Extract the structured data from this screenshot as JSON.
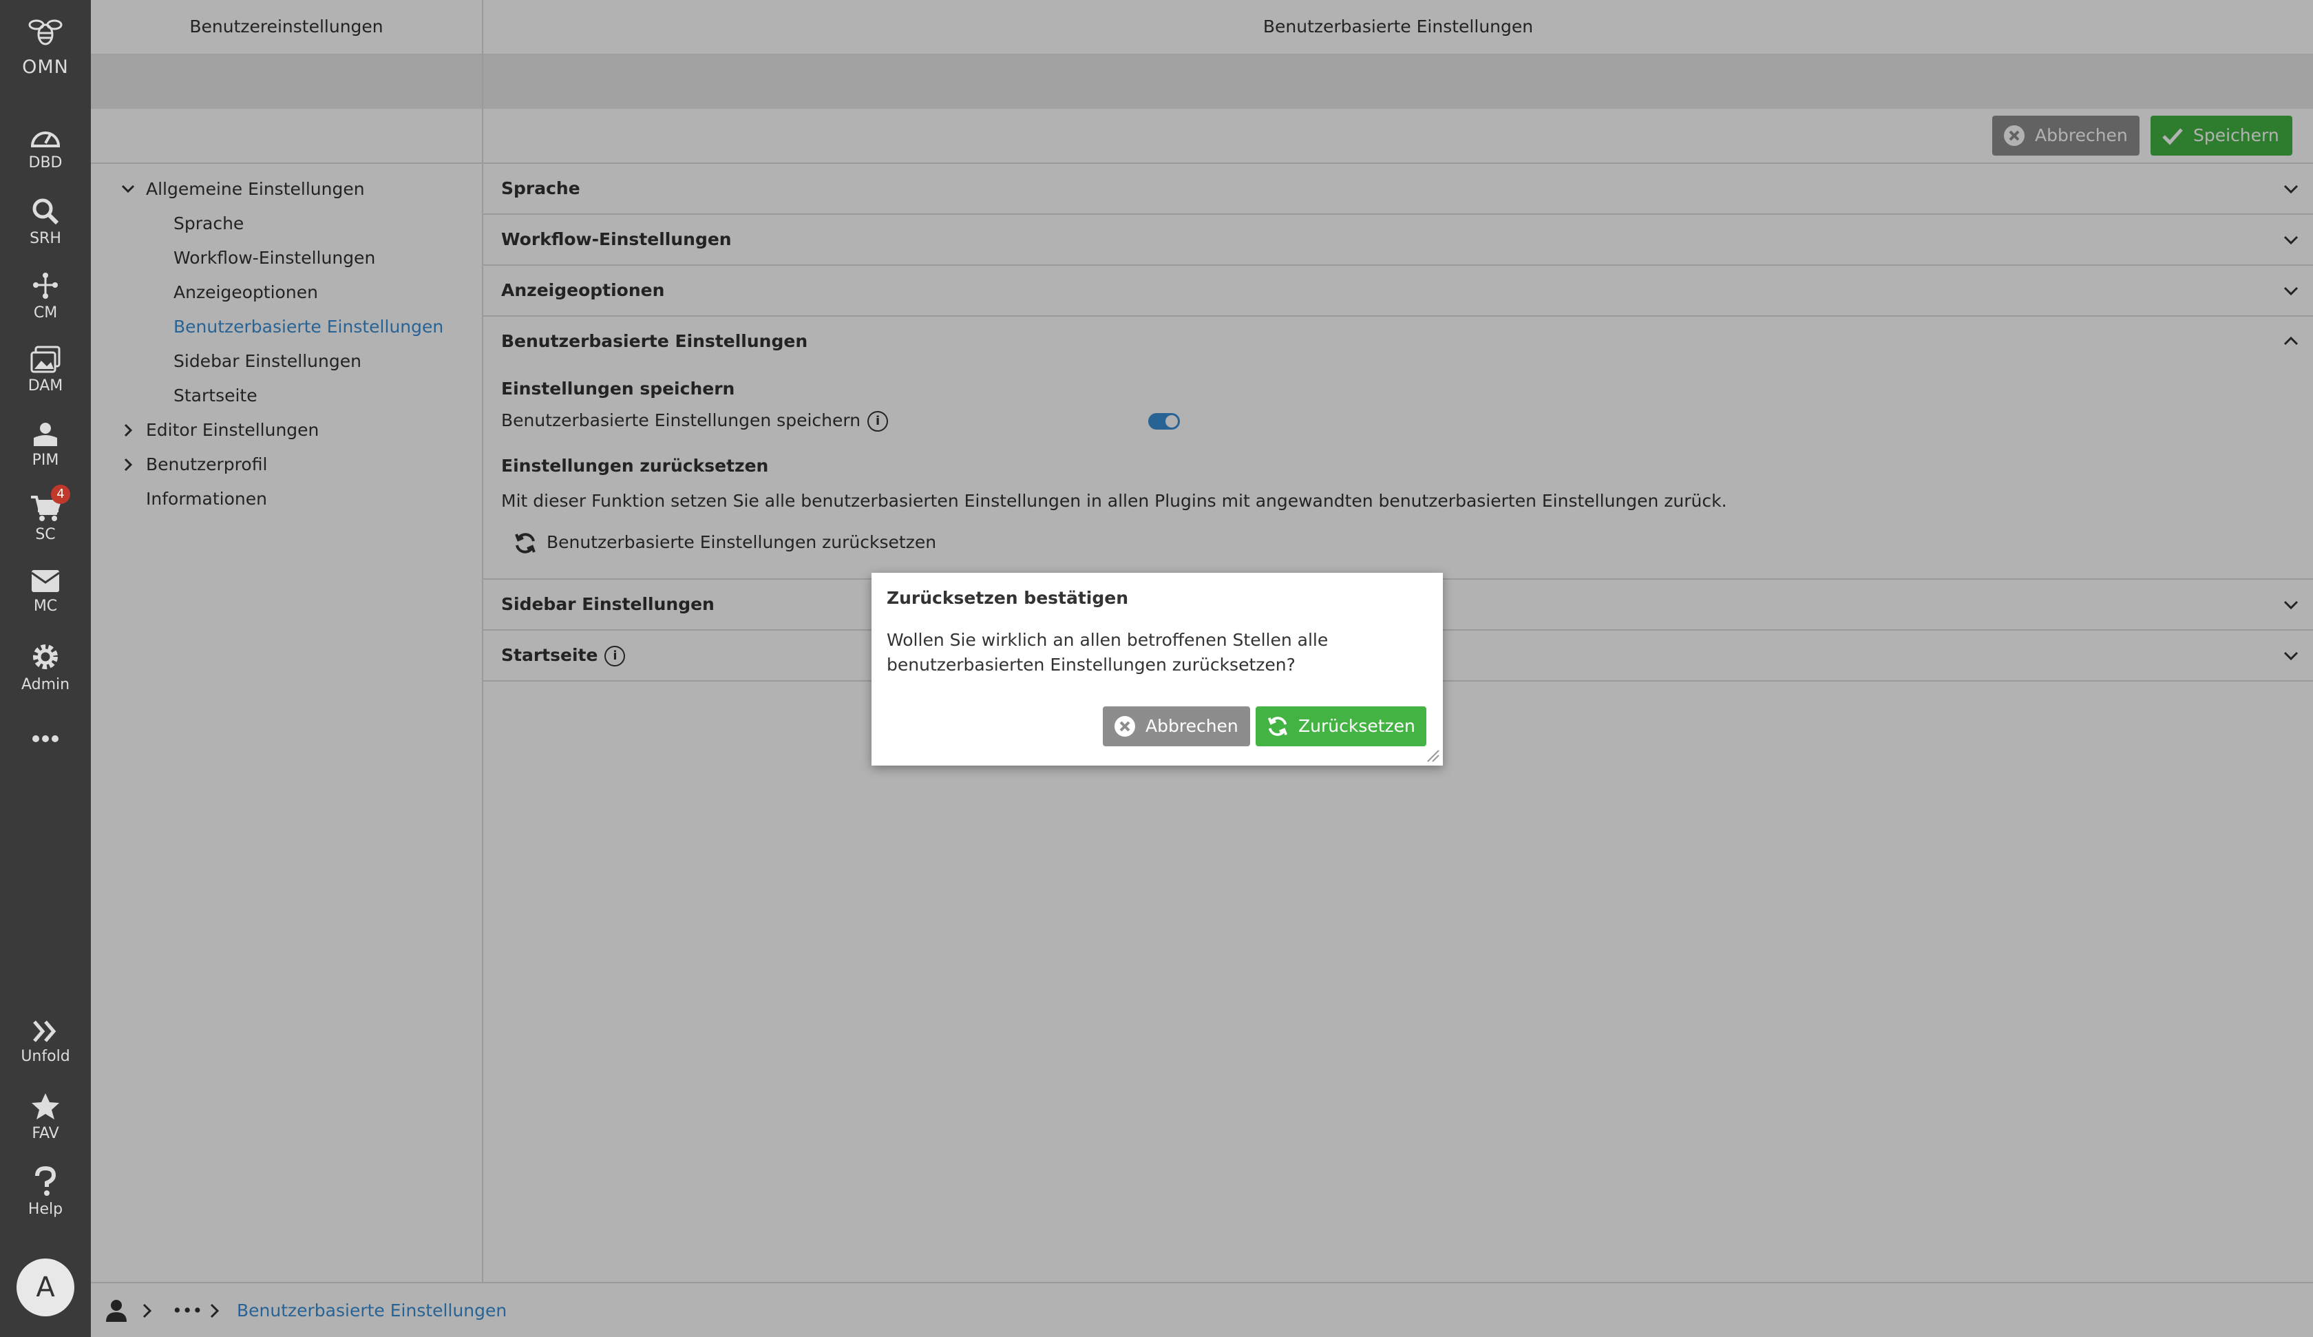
{
  "rail": {
    "logo_text": "OMN",
    "items": [
      {
        "label": "DBD",
        "icon": "dashboard-icon"
      },
      {
        "label": "SRH",
        "icon": "search-icon"
      },
      {
        "label": "CM",
        "icon": "content-tree-icon"
      },
      {
        "label": "DAM",
        "icon": "image-gallery-icon"
      },
      {
        "label": "PIM",
        "icon": "product-box-icon"
      },
      {
        "label": "SC",
        "icon": "cart-icon",
        "badge": "4"
      },
      {
        "label": "MC",
        "icon": "mail-icon"
      },
      {
        "label": "Admin",
        "icon": "admin-gear-icon"
      },
      {
        "label": "Unfold",
        "icon": "double-chevron-right-icon"
      },
      {
        "label": "FAV",
        "icon": "star-icon"
      },
      {
        "label": "Help",
        "icon": "question-icon"
      }
    ],
    "avatar": "A"
  },
  "tree_panel": {
    "title": "Benutzereinstellungen",
    "items": [
      {
        "label": "Allgemeine Einstellungen",
        "level": 0,
        "caret": "down"
      },
      {
        "label": "Sprache",
        "level": 1
      },
      {
        "label": "Workflow-Einstellungen",
        "level": 1
      },
      {
        "label": "Anzeigeoptionen",
        "level": 1
      },
      {
        "label": "Benutzerbasierte Einstellungen",
        "level": 1,
        "active": true
      },
      {
        "label": "Sidebar Einstellungen",
        "level": 1
      },
      {
        "label": "Startseite",
        "level": 1
      },
      {
        "label": "Editor Einstellungen",
        "level": 0,
        "caret": "right"
      },
      {
        "label": "Benutzerprofil",
        "level": 0,
        "caret": "right"
      },
      {
        "label": "Informationen",
        "level": 0
      }
    ]
  },
  "main": {
    "title": "Benutzerbasierte Einstellungen",
    "cancel_label": "Abbrechen",
    "save_label": "Speichern",
    "accordion": {
      "sprache": "Sprache",
      "workflow": "Workflow-Einstellungen",
      "anzeige": "Anzeigeoptionen",
      "userbased": "Benutzerbasierte Einstellungen",
      "sidebar": "Sidebar Einstellungen",
      "startseite": "Startseite"
    },
    "userbased": {
      "save_section_title": "Einstellungen speichern",
      "save_option_label": "Benutzerbasierte Einstellungen speichern",
      "save_option_enabled": true,
      "reset_section_title": "Einstellungen zurücksetzen",
      "reset_description": "Mit dieser Funktion setzen Sie alle benutzerbasierten Einstellungen in allen Plugins mit angewandten benutzerbasierten Einstellungen zurück.",
      "reset_link": "Benutzerbasierte Einstellungen zurücksetzen"
    }
  },
  "statusbar": {
    "ellipsis": "•••",
    "current": "Benutzerbasierte Einstellungen"
  },
  "dialog": {
    "title": "Zurücksetzen bestätigen",
    "message": "Wollen Sie wirklich an allen betroffenen Stellen alle benutzerbasierten Einstellungen zurücksetzen?",
    "cancel_label": "Abbrechen",
    "confirm_label": "Zurücksetzen"
  },
  "colors": {
    "rail_bg": "#3a3a3a",
    "accent_blue": "#3a8fd6",
    "button_green": "#43b343",
    "button_grey": "#8d8d8d",
    "badge_red": "#c0392b"
  }
}
